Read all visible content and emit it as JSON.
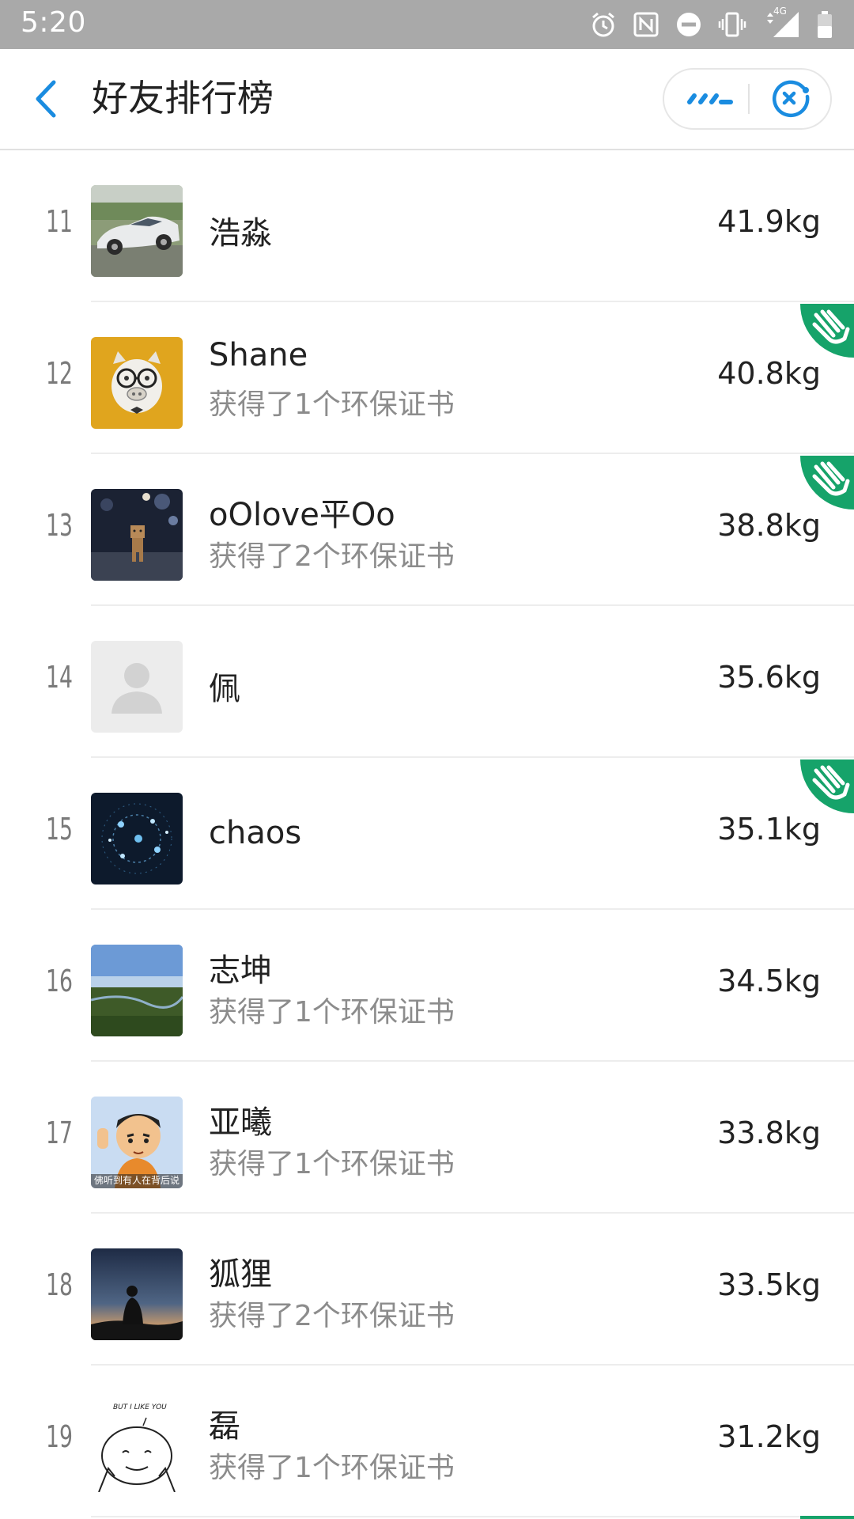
{
  "status_bar": {
    "time": "5:20",
    "network": "4G"
  },
  "header": {
    "title": "好友排行榜"
  },
  "colors": {
    "accent": "#1a8ce0",
    "badge_green": "#16a36a"
  },
  "ranking": [
    {
      "rank": "11",
      "name": "浩淼",
      "subtitle": "",
      "weight": "41.9kg",
      "avatar": "car-photo-avatar",
      "has_badge": false
    },
    {
      "rank": "12",
      "name": "Shane",
      "subtitle": "获得了1个环保证书",
      "weight": "40.8kg",
      "avatar": "pig-glasses-avatar",
      "has_badge": true
    },
    {
      "rank": "13",
      "name": "oOlove平Oo",
      "subtitle": "获得了2个环保证书",
      "weight": "38.8kg",
      "avatar": "box-robot-avatar",
      "has_badge": true
    },
    {
      "rank": "14",
      "name": "佩",
      "subtitle": "",
      "weight": "35.6kg",
      "avatar": "default-avatar",
      "has_badge": false
    },
    {
      "rank": "15",
      "name": "chaos",
      "subtitle": "",
      "weight": "35.1kg",
      "avatar": "galaxy-avatar",
      "has_badge": true
    },
    {
      "rank": "16",
      "name": "志坤",
      "subtitle": "获得了1个环保证书",
      "weight": "34.5kg",
      "avatar": "landscape-avatar",
      "has_badge": false
    },
    {
      "rank": "17",
      "name": "亚曦",
      "subtitle": "获得了1个环保证书",
      "weight": "33.8kg",
      "avatar": "cartoon-avatar",
      "has_badge": false
    },
    {
      "rank": "18",
      "name": "狐狸",
      "subtitle": "获得了2个环保证书",
      "weight": "33.5kg",
      "avatar": "silhouette-avatar",
      "has_badge": false
    },
    {
      "rank": "19",
      "name": "磊",
      "subtitle": "获得了1个环保证书",
      "weight": "31.2kg",
      "avatar": "sketch-face-avatar",
      "has_badge": false
    }
  ],
  "avatar_texts": {
    "cartoon": "佛听到有人在背后说",
    "sketch": "BUT I LIKE YOU"
  }
}
